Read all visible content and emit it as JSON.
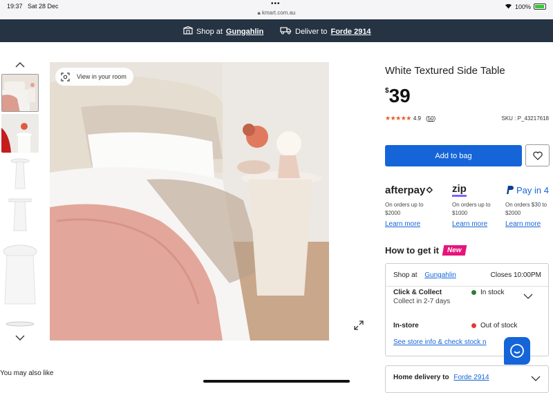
{
  "status": {
    "time": "19:37",
    "date": "Sat 28 Dec",
    "url": "kmart.com.au",
    "battery": "100%"
  },
  "nav": {
    "shop_prefix": "Shop at",
    "shop_store": "Gungahlin",
    "deliver_prefix": "Deliver to",
    "deliver_location": "Forde 2914"
  },
  "gallery": {
    "view_in_room": "View in your room"
  },
  "product": {
    "title": "White Textured Side Table",
    "currency": "$",
    "price": "39",
    "rating": "4.9",
    "review_count": "50",
    "rating_stars": 5,
    "sku": "SKU : P_43217618",
    "add_to_bag": "Add to bag"
  },
  "payments": [
    {
      "name": "afterpay",
      "desc": "On orders up to $2000",
      "link": "Learn more"
    },
    {
      "name": "zip",
      "desc": "On orders up to $1000",
      "link": "Learn more"
    },
    {
      "name": "Pay in 4",
      "desc": "On orders $30 to $2000",
      "link": "Learn more"
    }
  ],
  "fulfilment": {
    "heading": "How to get it",
    "badge": "New",
    "shop_at_label": "Shop at",
    "store": "Gungahlin",
    "closes": "Closes 10:00PM",
    "click_collect_title": "Click & Collect",
    "click_collect_sub": "Collect in 2-7 days",
    "click_collect_status": "In stock",
    "instore_title": "In-store",
    "instore_status": "Out of stock",
    "store_info_link": "See store info & check stock n",
    "home_delivery_label": "Home delivery to",
    "home_delivery_location": "Forde 2914"
  },
  "recommendations": {
    "heading": "You may also like"
  },
  "colors": {
    "nav_bg": "#253343",
    "primary": "#1565d8",
    "in_stock": "#2e7d32",
    "out_of_stock": "#e53935",
    "badge": "#e6157b",
    "star": "#e65a24"
  }
}
